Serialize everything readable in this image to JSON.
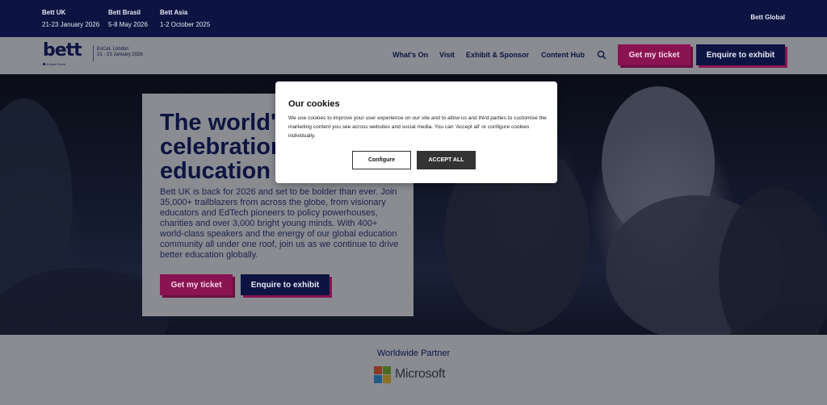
{
  "topbar": {
    "events": [
      {
        "name": "Bett UK",
        "date": "21-23 January 2026"
      },
      {
        "name": "Bett Brasil",
        "date": "5-8 May 2026"
      },
      {
        "name": "Bett Asia",
        "date": "1-2 October 2025"
      }
    ],
    "global_link": "Bett Global"
  },
  "header": {
    "logo_text": "bett",
    "logo_tagline": "A Hyve Event",
    "venue_name": "ExCeL London",
    "venue_dates": "21 - 23 January 2026",
    "nav": [
      "What's On",
      "Visit",
      "Exhibit & Sponsor",
      "Content Hub"
    ],
    "search_icon": "search-icon",
    "ticket_button": "Get my ticket",
    "exhibit_button": "Enquire to exhibit"
  },
  "hero": {
    "title": "The world's\ncelebration of\neducation",
    "body": "Bett UK is back for 2026 and set to be bolder than ever. Join 35,000+ trailblazers from across the globe, from visionary educators and EdTech pioneers to policy powerhouses, charities and over 3,000 bright young minds. With 400+ world-class speakers and the energy of our global education community all under one roof, join us as we continue to drive better education globally.",
    "ticket_button": "Get my ticket",
    "exhibit_button": "Enquire to exhibit"
  },
  "partner": {
    "label": "Worldwide Partner",
    "brand": "Microsoft"
  },
  "cookie_modal": {
    "title": "Our cookies",
    "text": "We use cookies to improve your user experience on our site and to allow us and third parties to customise the marketing content you see across websites and social media. You can 'Accept all' or configure cookies individually.",
    "configure_button": "Configure",
    "accept_button": "ACCEPT ALL"
  },
  "colors": {
    "navy": "#0d1442",
    "magenta": "#8a1451",
    "overlay_grey": "#8a8c92"
  }
}
